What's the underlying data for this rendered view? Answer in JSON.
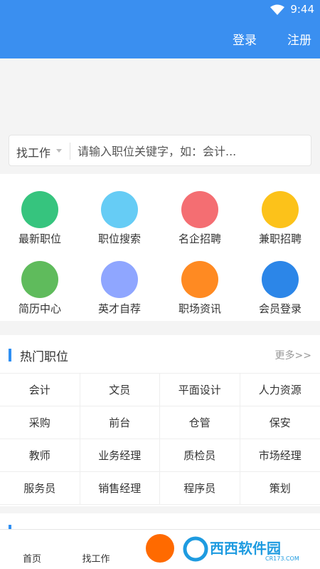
{
  "status_bar": {
    "time": "9:44",
    "icon": "wifi-icon"
  },
  "header": {
    "login": "登录",
    "register": "注册"
  },
  "search": {
    "type": "找工作",
    "placeholder": "请输入职位关键字，如：会计..."
  },
  "menu": [
    {
      "label": "最新职位",
      "color": "#36c47e"
    },
    {
      "label": "职位搜索",
      "color": "#66ccf5"
    },
    {
      "label": "名企招聘",
      "color": "#f46e72"
    },
    {
      "label": "兼职招聘",
      "color": "#fcc21a"
    },
    {
      "label": "简历中心",
      "color": "#5fbb5c"
    },
    {
      "label": "英才自荐",
      "color": "#8fa6ff"
    },
    {
      "label": "职场资讯",
      "color": "#ff8a22"
    },
    {
      "label": "会员登录",
      "color": "#2c86e8"
    }
  ],
  "hot_jobs": {
    "title": "热门职位",
    "more": "更多>>",
    "items": [
      "会计",
      "文员",
      "平面设计",
      "人力资源",
      "采购",
      "前台",
      "仓管",
      "保安",
      "教师",
      "业务经理",
      "质检员",
      "市场经理",
      "服务员",
      "销售经理",
      "程序员",
      "策划"
    ]
  },
  "tabbar": {
    "tabs": [
      "首页",
      "找工作"
    ],
    "center_color": "#ff6a00"
  },
  "watermark": {
    "text": "西西软件园",
    "sub": "CR173.COM"
  }
}
